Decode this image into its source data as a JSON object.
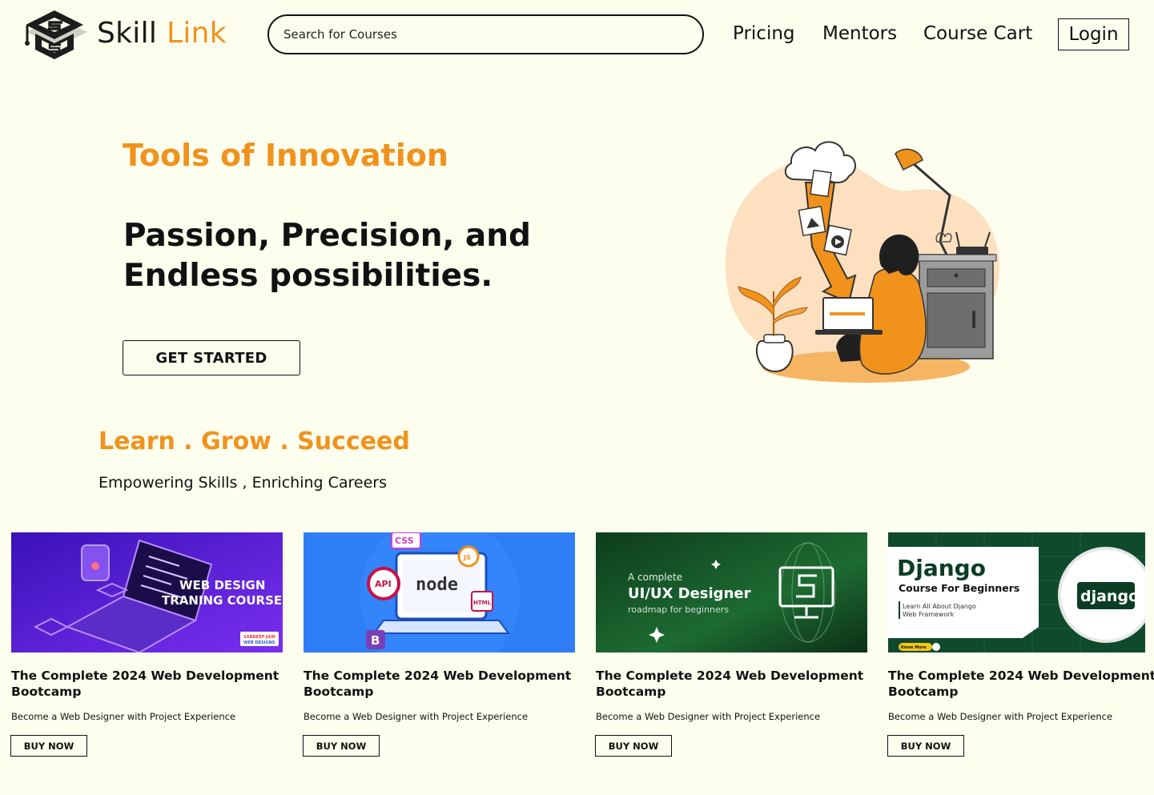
{
  "brand": {
    "name_part1": "Skill",
    "name_part2": "Link",
    "accent": "#f0921c"
  },
  "search": {
    "placeholder": "Search for Courses",
    "value": ""
  },
  "nav": {
    "pricing": "Pricing",
    "mentors": "Mentors",
    "cart": "Course Cart",
    "login": "Login"
  },
  "hero": {
    "kicker": "Tools of Innovation",
    "title": "Passion, Precision, and Endless possibilities.",
    "cta": "GET STARTED",
    "illustration_icon": "woman-laptop-cloud-illustration"
  },
  "tagline": {
    "headline": "Learn . Grow . Succeed",
    "subhead": "Empowering Skills , Enriching Careers"
  },
  "courses": [
    {
      "thumb_text_1": "WEB DESIGN",
      "thumb_text_2": "TRANING COURSE",
      "thumb_badge_1": "SANDEEP JAIN",
      "thumb_badge_2": "WEB DESIGNS",
      "title": "The Complete 2024 Web Development Bootcamp",
      "desc": "Become a Web Designer with Project Experience",
      "buy": "BUY NOW"
    },
    {
      "thumb_text_1": "node",
      "thumb_tag_css": "CSS",
      "thumb_tag_js": "JS",
      "thumb_tag_api": "API",
      "thumb_tag_html": "HTML",
      "thumb_tag_b": "B",
      "title": "The Complete 2024 Web Development Bootcamp",
      "desc": "Become a Web Designer with Project Experience",
      "buy": "BUY NOW"
    },
    {
      "thumb_text_1": "A complete",
      "thumb_text_2": "UI/UX Designer",
      "thumb_text_3": "roadmap for beginners",
      "title": "The Complete 2024 Web Development Bootcamp",
      "desc": "Become a Web Designer with Project Experience",
      "buy": "BUY NOW"
    },
    {
      "thumb_text_1": "Django",
      "thumb_text_2": "Course For Beginners",
      "thumb_text_3": "Learn All About Django",
      "thumb_text_4": "Web Framework",
      "thumb_badge_1": "Know More",
      "thumb_logo": "django",
      "title": "The Complete 2024 Web Development Bootcamp",
      "desc": "Become a Web Designer with Project Experience",
      "buy": "BUY NOW"
    }
  ]
}
